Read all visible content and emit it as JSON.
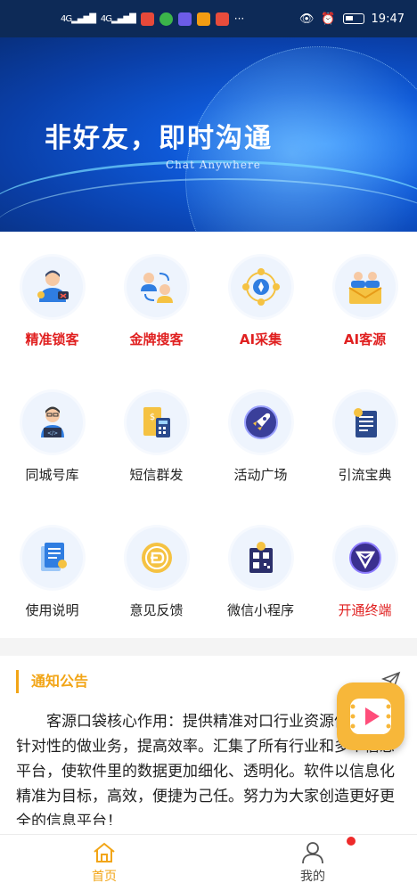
{
  "status_bar": {
    "signal_left": "4G",
    "signal_right": "4G",
    "time": "19:47",
    "more": "···"
  },
  "banner": {
    "title": "非好友，即时沟通",
    "subtitle": "Chat Anywhere"
  },
  "grid": [
    {
      "label": "精准锁客",
      "icon": "lock-customer-icon",
      "style": "red"
    },
    {
      "label": "金牌搜客",
      "icon": "search-customer-icon",
      "style": "red"
    },
    {
      "label": "AI采集",
      "icon": "ai-collect-icon",
      "style": "red"
    },
    {
      "label": "AI客源",
      "icon": "ai-source-icon",
      "style": "red"
    },
    {
      "label": "同城号库",
      "icon": "city-number-icon",
      "style": "normal"
    },
    {
      "label": "短信群发",
      "icon": "sms-icon",
      "style": "normal"
    },
    {
      "label": "活动广场",
      "icon": "rocket-icon",
      "style": "normal"
    },
    {
      "label": "引流宝典",
      "icon": "guide-book-icon",
      "style": "normal"
    },
    {
      "label": "使用说明",
      "icon": "manual-icon",
      "style": "normal"
    },
    {
      "label": "意见反馈",
      "icon": "feedback-coin-icon",
      "style": "normal"
    },
    {
      "label": "微信小程序",
      "icon": "qrcode-icon",
      "style": "normal"
    },
    {
      "label": "开通终端",
      "icon": "terminal-icon",
      "style": "red-normal"
    }
  ],
  "notice": {
    "title": "通知公告",
    "body": "客源口袋核心作用：提供精准对口行业资源信息，有针对性的做业务，提高效率。汇集了所有行业和多个信息平台，使软件里的数据更加细化、透明化。软件以信息化精准为目标，高效，便捷为己任。努力为大家创造更好更全的信息平台！"
  },
  "tabs": {
    "home": "首页",
    "mine": "我的"
  },
  "colors": {
    "accent": "#f2a516",
    "red": "#e02020"
  }
}
